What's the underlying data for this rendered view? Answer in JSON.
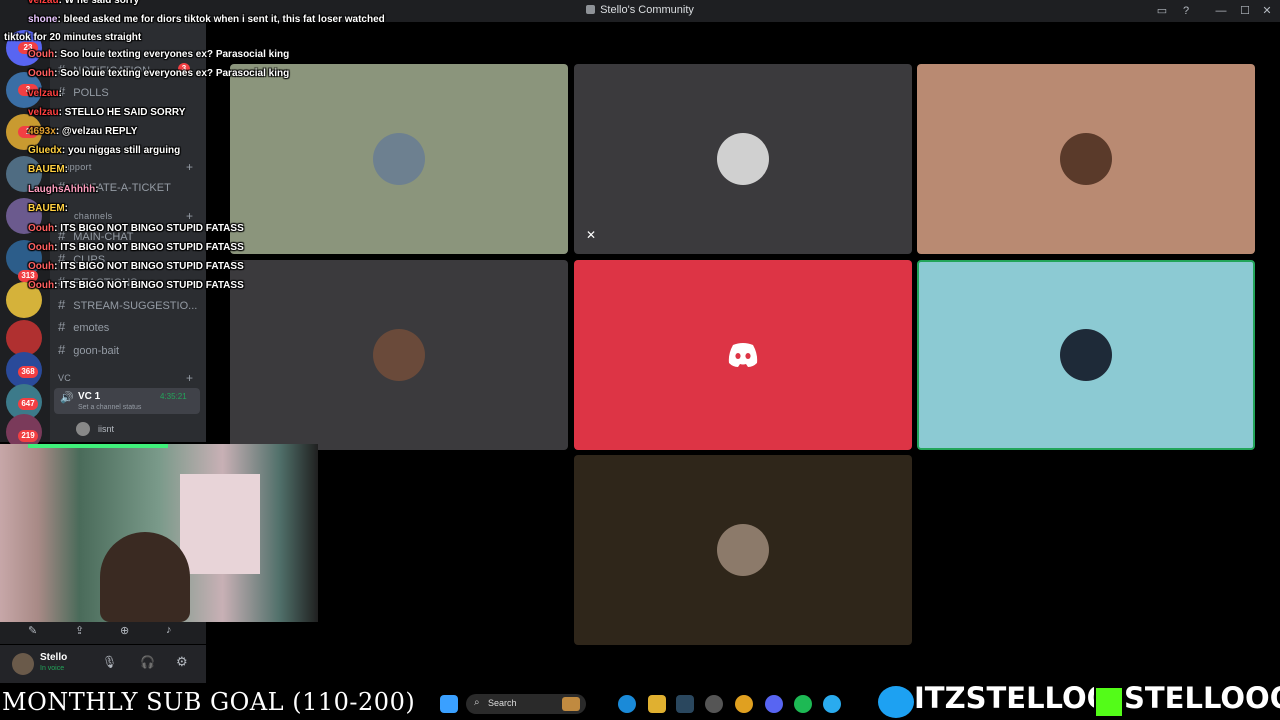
{
  "window": {
    "title": "Stello's Community"
  },
  "server_badges": [
    "23",
    "3",
    "1",
    "313",
    "368",
    "647",
    "219"
  ],
  "channels": {
    "items": [
      {
        "name": "NOTIFICATION",
        "badge": "3"
      },
      {
        "name": "POLLS"
      },
      {
        "name": "CREATE-A-TICKET"
      },
      {
        "name": "MAIN-CHAT"
      },
      {
        "name": "CLIPS"
      },
      {
        "name": "REACTIONS"
      },
      {
        "name": "STREAM-SUGGESTIO..."
      },
      {
        "name": "emotes"
      },
      {
        "name": "goon-bait"
      }
    ],
    "categories": {
      "support": "Support",
      "text": "channels",
      "vc": "VC"
    },
    "vc": {
      "name": "VC 1",
      "timer": "4:35:21",
      "status": "Set a channel status",
      "member": "iisnt"
    }
  },
  "user_panel": {
    "name": "Stello",
    "status": "In voice"
  },
  "chat": [
    {
      "user": "velzau",
      "color": "#ff4040",
      "msg": ": W he said sorry"
    },
    {
      "user": "shone",
      "color": "#e8c6ff",
      "msg": ": bleed asked me for diors tiktok when i sent it, this fat loser watched"
    },
    {
      "user": "",
      "color": "#fff",
      "msg": "tiktok for 20 minutes straight"
    },
    {
      "user": "Oouh",
      "color": "#ff6060",
      "msg": ": Soo louie texting everyones ex? Parasocial king"
    },
    {
      "user": "Oouh",
      "color": "#ff6060",
      "msg": ": Soo louie texting everyones ex? Parasocial king"
    },
    {
      "user": "velzau",
      "color": "#ff4040",
      "msg": ":"
    },
    {
      "user": "velzau",
      "color": "#ff4040",
      "msg": ": STELLO HE SAID SORRY"
    },
    {
      "user": "4693x",
      "color": "#e0a030",
      "msg": ": @velzau REPLY"
    },
    {
      "user": "Gluedx",
      "color": "#ffd040",
      "msg": ": you niggas still arguing"
    },
    {
      "user": "BAUEM",
      "color": "#ffd040",
      "msg": ":"
    },
    {
      "user": "LaughsAhhhh",
      "color": "#ff9fc0",
      "msg": ":"
    },
    {
      "user": "BAUEM",
      "color": "#ffd040",
      "msg": ":"
    },
    {
      "user": "Oouh",
      "color": "#ff6060",
      "msg": ": ITS BIGO NOT BINGO STUPID FATASS"
    },
    {
      "user": "Oouh",
      "color": "#ff6060",
      "msg": ": ITS BIGO NOT BINGO STUPID FATASS"
    },
    {
      "user": "Oouh",
      "color": "#ff6060",
      "msg": ": ITS BIGO NOT BINGO STUPID FATASS"
    },
    {
      "user": "Oouh",
      "color": "#ff6060",
      "msg": ": ITS BIGO NOT BINGO STUPID FATASS"
    }
  ],
  "tiles": [
    {
      "bg": "#8b957c",
      "avatar": "#6d8090"
    },
    {
      "bg": "#3b3a3d",
      "avatar": "#d0d0d0",
      "muted": true
    },
    {
      "bg": "#b98a72",
      "avatar": "#5a3a2a"
    },
    {
      "bg": "#3b3a3d",
      "avatar": "#6a4a3a"
    },
    {
      "bg": "#dd3445",
      "avatar": "discord-logo"
    },
    {
      "bg": "#8ccad3",
      "avatar": "#1e2a38",
      "speaking": true
    },
    {
      "bg": "#2f261a",
      "avatar": "#8c7a6a"
    }
  ],
  "overlay": {
    "subgoal": "MONTHLY SUB GOAL (110-200)",
    "twitter": "ITZSTELLOO",
    "kick": "STELLOOO"
  },
  "taskbar": {
    "search": "Search"
  }
}
